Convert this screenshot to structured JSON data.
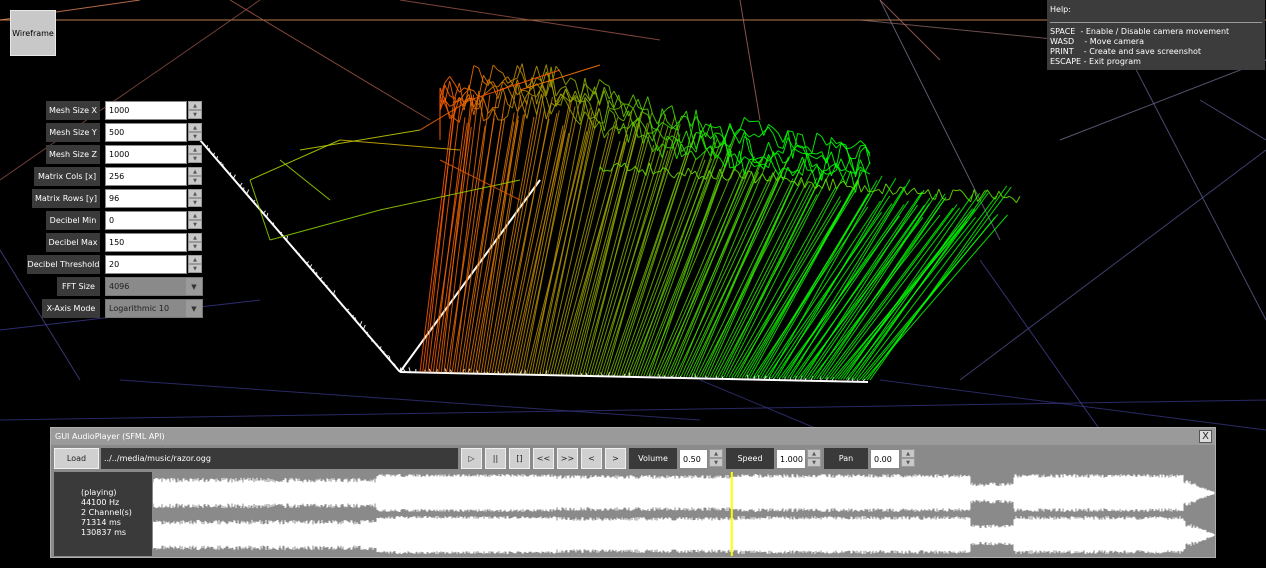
{
  "wireframe_label": "Wireframe",
  "help": {
    "title": "Help:",
    "rows": [
      "SPACE  - Enable / Disable camera movement",
      "WASD    - Move camera",
      "PRINT    - Create and save screenshot",
      "ESCAPE - Exit program"
    ]
  },
  "params": [
    {
      "label": "Mesh Size X",
      "value": "1000"
    },
    {
      "label": "Mesh Size Y",
      "value": "500"
    },
    {
      "label": "Mesh Size Z",
      "value": "1000"
    },
    {
      "label": "Matrix Cols [x]",
      "value": "256"
    },
    {
      "label": "Matrix Rows [y]",
      "value": "96"
    },
    {
      "label": "Decibel Min",
      "value": "0"
    },
    {
      "label": "Decibel Max",
      "value": "150"
    },
    {
      "label": "Decibel Threshold",
      "value": "20"
    }
  ],
  "fft_size": {
    "label": "FFT Size",
    "value": "4096"
  },
  "x_axis_mode": {
    "label": "X-Axis Mode",
    "value": "Logarithmic 10"
  },
  "player": {
    "title": "GUI AudioPlayer (SFML API)",
    "close": "X",
    "load": "Load",
    "file_path": "../../media/music/razor.ogg",
    "transport": [
      "▷",
      "||",
      "[]",
      "<<",
      ">>",
      "<",
      ">"
    ],
    "volume_label": "Volume",
    "volume_value": "0.50",
    "speed_label": "Speed",
    "speed_value": "1.000",
    "pan_label": "Pan",
    "pan_value": "0.00",
    "status": {
      "state": "(playing)",
      "rate": "44100 Hz",
      "channels": "2 Channel(s)",
      "position": "71314 ms",
      "duration": "130837 ms"
    },
    "progress": 0.545
  },
  "colors": {
    "waveform": "#ffffff",
    "cursor": "#ffff00",
    "mesh_low": "#00ff00",
    "mesh_high": "#ff3000"
  }
}
